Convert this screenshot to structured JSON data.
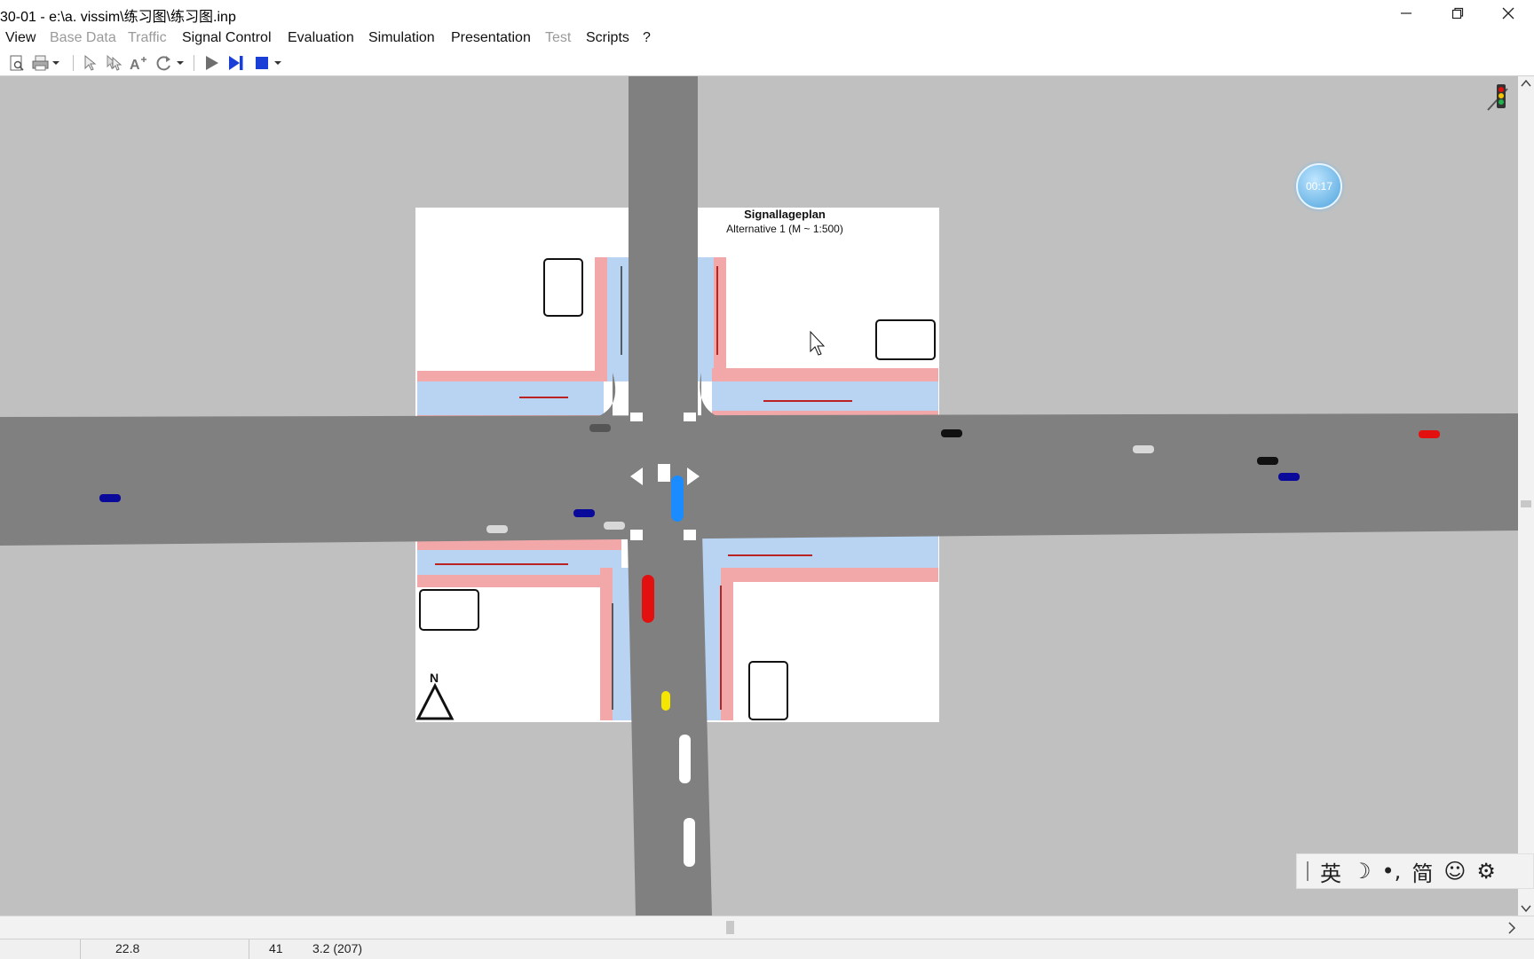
{
  "window": {
    "title": "30-01 - e:\\a. vissim\\练习图\\练习图.inp",
    "controls": [
      "minimize",
      "restore",
      "close"
    ]
  },
  "menu": [
    {
      "label": "View",
      "enabled": true
    },
    {
      "label": "Base Data",
      "enabled": false
    },
    {
      "label": "Traffic",
      "enabled": false
    },
    {
      "label": "Signal Control",
      "enabled": true
    },
    {
      "label": "Evaluation",
      "enabled": true
    },
    {
      "label": "Simulation",
      "enabled": true
    },
    {
      "label": "Presentation",
      "enabled": true
    },
    {
      "label": "Test",
      "enabled": false
    },
    {
      "label": "Scripts",
      "enabled": true
    },
    {
      "label": "?",
      "enabled": true
    }
  ],
  "toolbar": {
    "icons": [
      "print-preview-icon",
      "print-icon",
      "select-icon",
      "multi-select-icon",
      "text-size-icon",
      "rotate-icon",
      "play-icon",
      "single-step-icon",
      "stop-icon"
    ]
  },
  "map": {
    "plan_title": "Signallageplan",
    "plan_subtitle": "Alternative 1 (M ~ 1:500)",
    "north_label": "N"
  },
  "overlay": {
    "timer_text": "00:17"
  },
  "status": {
    "field1": "22.8",
    "field2": "41",
    "field3": "3.2  (207)"
  },
  "ime": {
    "items": [
      "英",
      "☽",
      "•,",
      "简",
      "☺",
      "⚙"
    ]
  },
  "colors": {
    "background": "#c0c0c0",
    "road": "#808080",
    "lane_blue": "#b9d3f2",
    "kerb_pink": "#f2a8a8"
  }
}
